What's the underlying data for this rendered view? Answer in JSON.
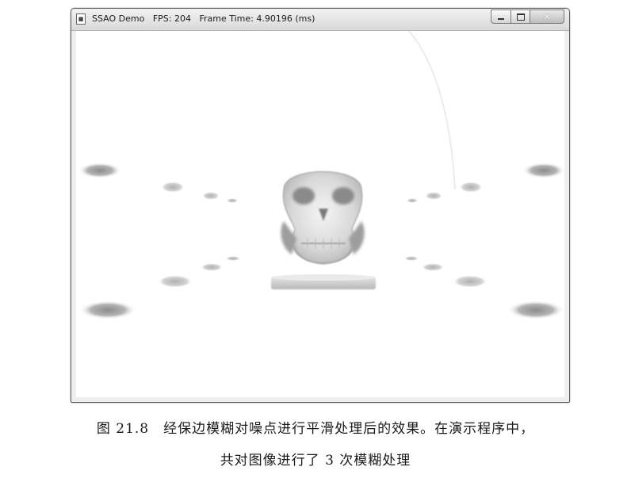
{
  "window": {
    "app_icon": "app-icon",
    "title": "SSAO Demo   FPS: 204   Frame Time: 4.90196 (ms)",
    "buttons": {
      "minimize": "minimize-icon",
      "maximize": "maximize-icon",
      "close": "close-icon"
    }
  },
  "caption": {
    "figure_number": "图 21.8",
    "line1": "经保边模糊对噪点进行平滑处理后的效果。在演示程序中，",
    "line2": "共对图像进行了 3 次模糊处理"
  }
}
